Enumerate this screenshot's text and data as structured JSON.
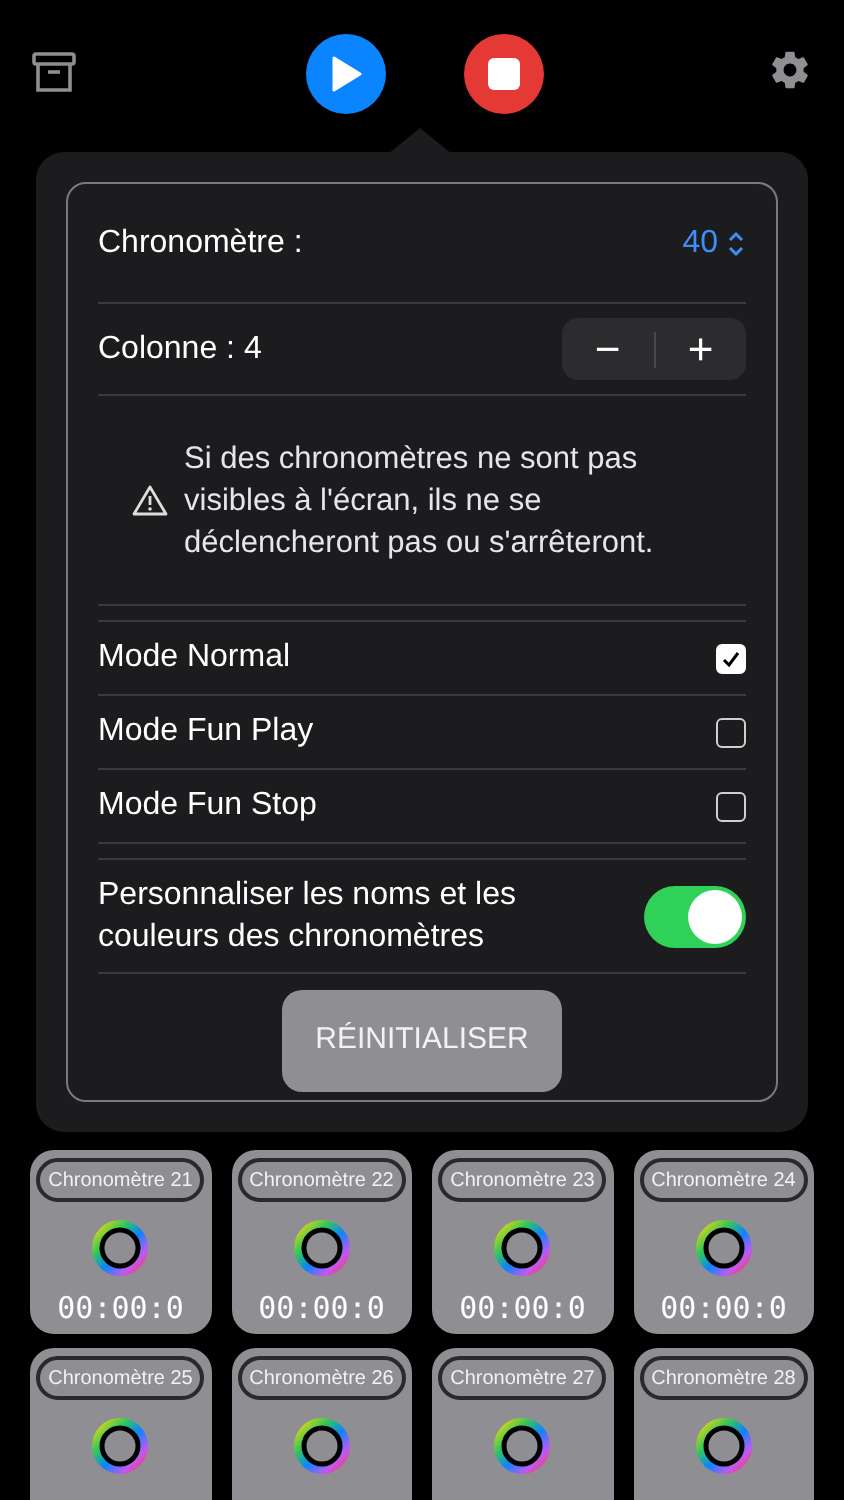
{
  "settings": {
    "timer_count_label": "Chronomètre :",
    "timer_count_value": "40",
    "column_label": "Colonne : 4",
    "column_stepper": {
      "minus": "−",
      "plus": "+"
    },
    "warning": "Si des chronomètres ne sont pas visibles à l'écran, ils ne se déclencheront pas ou s'arrêteront.",
    "modes": [
      {
        "label": "Mode Normal",
        "checked": true
      },
      {
        "label": "Mode Fun Play",
        "checked": false
      },
      {
        "label": "Mode Fun Stop",
        "checked": false
      }
    ],
    "customize": {
      "label": "Personnaliser les noms et les couleurs des chronomètres",
      "on": true
    },
    "reset_button": "RÉINITIALISER"
  },
  "timers": [
    {
      "name": "Chronomètre 21",
      "time": "00:00:0"
    },
    {
      "name": "Chronomètre 22",
      "time": "00:00:0"
    },
    {
      "name": "Chronomètre 23",
      "time": "00:00:0"
    },
    {
      "name": "Chronomètre 24",
      "time": "00:00:0"
    },
    {
      "name": "Chronomètre 25"
    },
    {
      "name": "Chronomètre 26"
    },
    {
      "name": "Chronomètre 27"
    },
    {
      "name": "Chronomètre 28"
    }
  ]
}
